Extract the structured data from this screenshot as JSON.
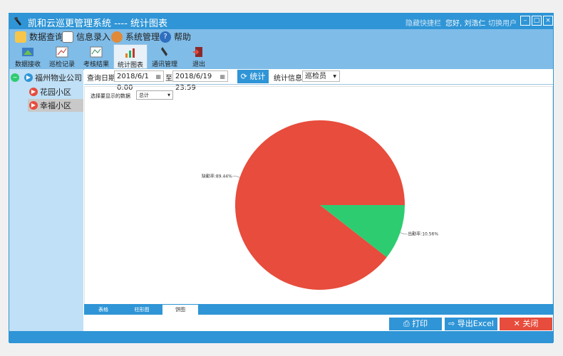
{
  "window": {
    "title": "凯和云巡更管理系统 ---- 统计图表",
    "hide_shortcuts": "隐藏快捷栏",
    "greeting": "您好, 刘浩仁",
    "switch_user": "切换用户",
    "min_glyph": "–",
    "max_glyph": "□",
    "close_glyph": "×"
  },
  "menu": [
    "数据查询",
    "信息录入",
    "系统管理",
    "帮助"
  ],
  "toolbar": [
    "数据接收",
    "巡检记录",
    "考核结果",
    "统计图表",
    "通讯管理",
    "退出"
  ],
  "tree": {
    "root": "福州物业公司",
    "children": [
      "花园小区",
      "幸福小区"
    ],
    "collapse_glyph": "−",
    "expand_glyph": "▶"
  },
  "query": {
    "date_label": "查询日期",
    "start": "2018/6/1 0:00",
    "to": "至",
    "end": "2018/6/19 23:59",
    "stat_button": "统计",
    "stat_info_label": "统计信息",
    "stat_info_value": "巡检员"
  },
  "panel": {
    "select_label": "选择要显示的数据",
    "select_value": "总计"
  },
  "chart_data": {
    "type": "pie",
    "slices": [
      {
        "label": "缺勤率",
        "value": 89.44,
        "display": "缺勤率:89.44%",
        "color": "#e74c3c"
      },
      {
        "label": "出勤率",
        "value": 10.56,
        "display": "出勤率:10.56%",
        "color": "#2ecc71"
      }
    ]
  },
  "tabs": [
    "表格",
    "柱形图",
    "饼图"
  ],
  "actions": {
    "print": "打印",
    "export": "导出Excel",
    "close": "关闭"
  }
}
